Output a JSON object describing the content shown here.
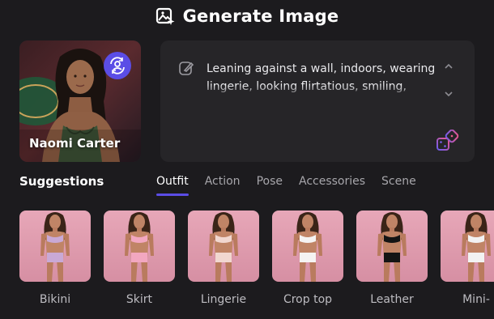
{
  "header": {
    "title": "Generate Image",
    "icon": "image-sparkle-icon"
  },
  "character": {
    "name": "Naomi Carter",
    "swap_icon": "swap-character-icon"
  },
  "prompt": {
    "text": "Leaning against a wall, indoors, wearing lingerie, looking flirtatious, smiling, seductive, teasing",
    "edit_icon": "edit-icon",
    "random_icon": "dice-icon",
    "colors": {
      "dice_gradient_start": "#6b5cf0",
      "dice_gradient_end": "#f0568a"
    }
  },
  "suggestions": {
    "title": "Suggestions",
    "tabs": [
      {
        "label": "Outfit",
        "active": true
      },
      {
        "label": "Action",
        "active": false
      },
      {
        "label": "Pose",
        "active": false
      },
      {
        "label": "Accessories",
        "active": false
      },
      {
        "label": "Scene",
        "active": false
      }
    ],
    "items": [
      {
        "label": "Bikini",
        "outfit_color": "#c9a9d6"
      },
      {
        "label": "Skirt",
        "outfit_color": "#f2a7c0"
      },
      {
        "label": "Lingerie",
        "outfit_color": "#f1d7d0"
      },
      {
        "label": "Crop top",
        "outfit_color": "#f5f3f2"
      },
      {
        "label": "Leather",
        "outfit_color": "#141414"
      },
      {
        "label": "Mini-",
        "outfit_color": "#f2f2f2"
      }
    ]
  },
  "colors": {
    "accent": "#5b4de6",
    "background": "#1c1b1e",
    "panel": "#262528"
  }
}
